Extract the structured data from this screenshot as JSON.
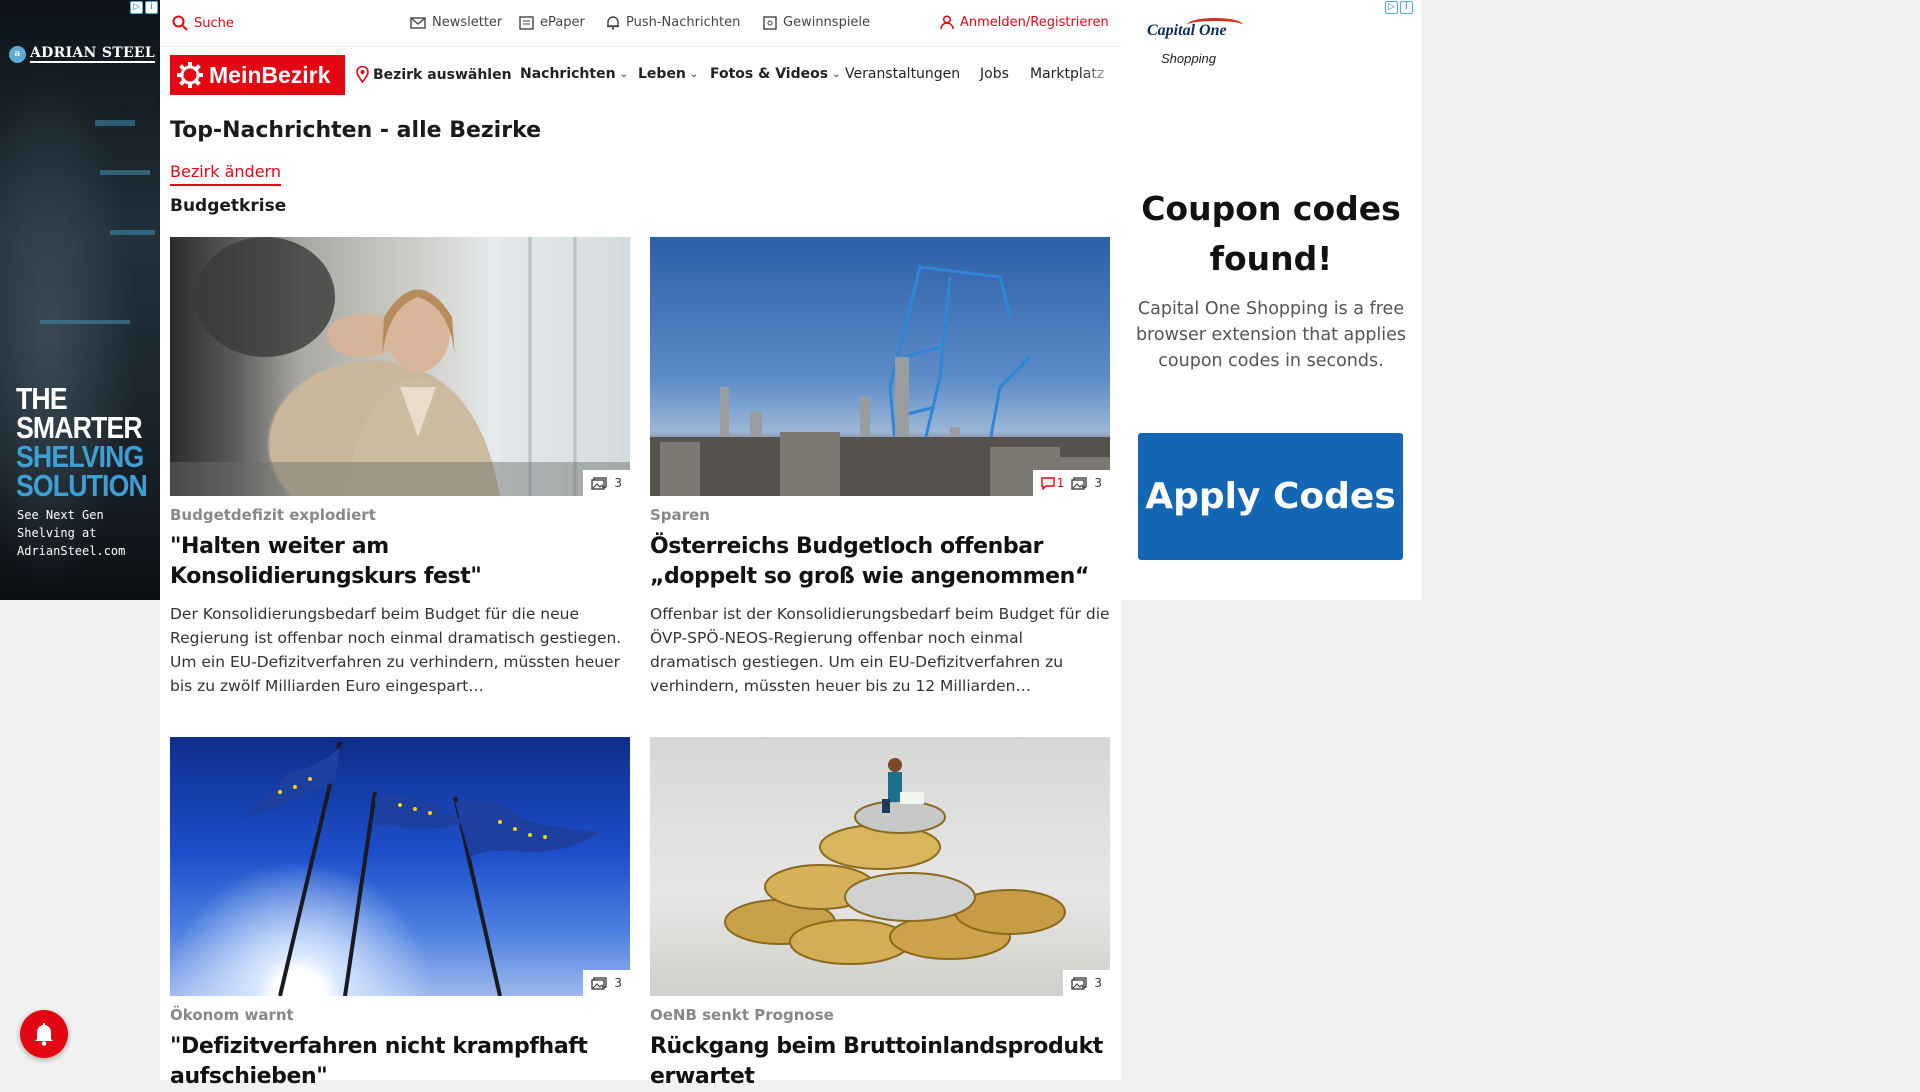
{
  "left_ad": {
    "brand": "ADRIAN STEEL",
    "headline": [
      "THE",
      "SMARTER",
      "SHELVING",
      "SOLUTION"
    ],
    "subtext": [
      "See Next Gen",
      "Shelving at",
      "AdrianSteel.com"
    ]
  },
  "topbar": {
    "search": "Suche",
    "newsletter": "Newsletter",
    "epaper": "ePaper",
    "push": "Push-Nachrichten",
    "games": "Gewinnspiele",
    "login": "Anmelden/Registrieren"
  },
  "nav": {
    "logo": "MeinBezirk",
    "district": "Bezirk auswählen",
    "items": [
      "Nachrichten",
      "Leben",
      "Fotos & Videos",
      "Veranstaltungen",
      "Jobs",
      "Marktplatz"
    ]
  },
  "main": {
    "title": "Top-Nachrichten - alle Bezirke",
    "change_district": "Bezirk ändern",
    "topic": "Budgetkrise",
    "cards": [
      {
        "kicker": "Budgetdefizit explodiert",
        "title": "\"Halten weiter am Konsolidierungskurs fest\"",
        "teaser": "Der Konsolidierungsbedarf beim Budget für die neue Regierung ist offenbar noch einmal dramatisch gestiegen. Um ein EU-Defizitverfahren zu verhindern, müssten heuer bis zu zwölf Milliarden Euro eingespart…",
        "photos": "3",
        "comments": ""
      },
      {
        "kicker": "Sparen",
        "title": "Österreichs Budgetloch offenbar „doppelt so groß wie angenommen“",
        "teaser": "Offenbar ist der Konsolidierungsbedarf beim Budget für die ÖVP-SPÖ-NEOS-Regierung offenbar noch einmal dramatisch gestiegen. Um ein EU-Defizitverfahren zu verhindern, müssten heuer bis zu 12 Milliarden eingespar…",
        "photos": "3",
        "comments": "1"
      },
      {
        "kicker": "Ökonom warnt",
        "title": "\"Defizitverfahren nicht krampfhaft aufschieben\"",
        "teaser": "",
        "photos": "3",
        "comments": ""
      },
      {
        "kicker": "OeNB senkt Prognose",
        "title": "Rückgang beim Bruttoinlandsprodukt erwartet",
        "teaser": "",
        "photos": "3",
        "comments": ""
      }
    ]
  },
  "right_ad": {
    "logo": "Capital One",
    "logo_sub": "Shopping",
    "headline": "Coupon codes found!",
    "body": "Capital One Shopping is a free browser extension that applies coupon codes in seconds.",
    "button": "Apply Codes"
  },
  "colors": {
    "brand_red": "#e30613",
    "ad_blue": "#1366b4"
  },
  "icons": [
    "search-icon",
    "mail-icon",
    "newspaper-icon",
    "bell-icon",
    "puzzle-icon",
    "user-icon",
    "location-pin-icon",
    "photo-icon",
    "comment-icon",
    "chevron-down-icon"
  ]
}
